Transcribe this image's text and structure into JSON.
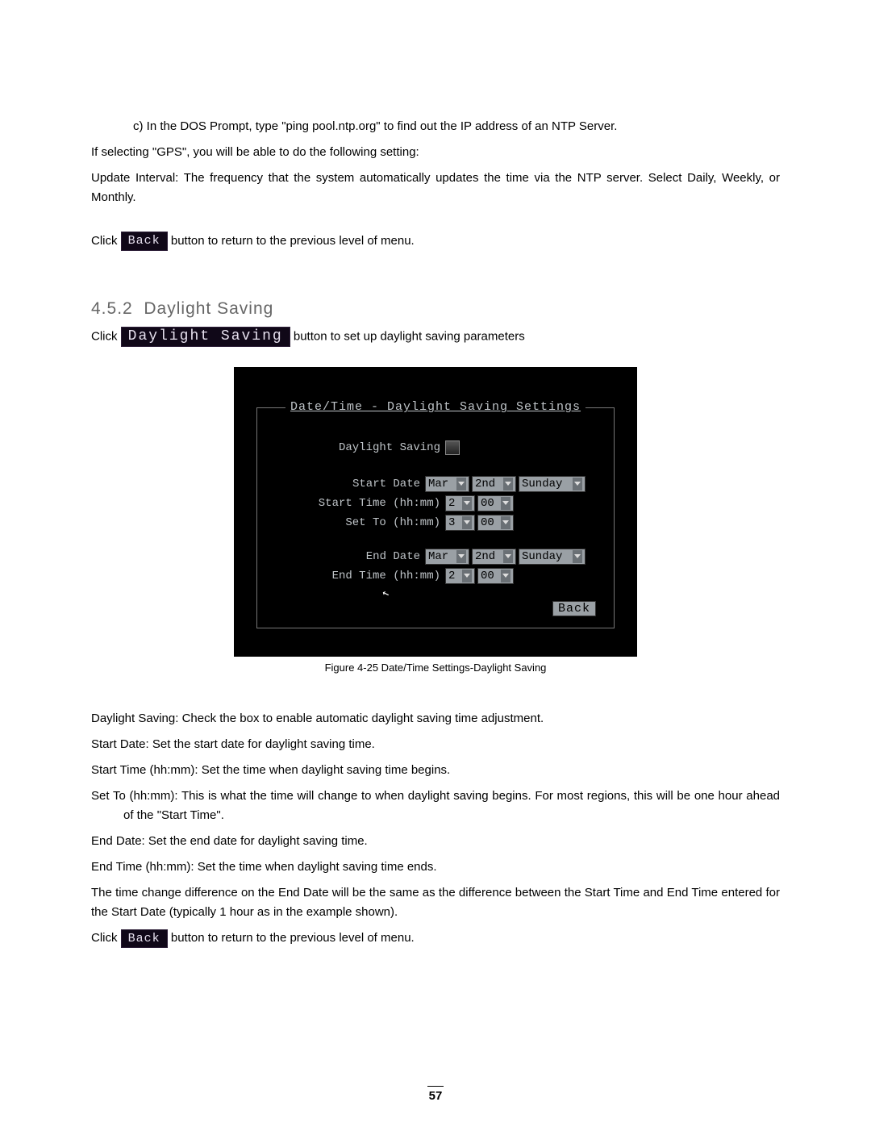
{
  "intro": {
    "line_c": "c) In the DOS Prompt, type \"ping pool.ntp.org\" to find out the IP address of an NTP Server.",
    "gps_line": "If selecting \"GPS\", you will be able to do the following setting:",
    "update_label": "Update Interval:",
    "update_text": " The frequency that the system automatically updates the time via the NTP server. Select Daily, Weekly, or Monthly.",
    "click1": "Click ",
    "back_chip": "Back",
    "click1_tail": " button to return to the previous level of menu."
  },
  "section": {
    "number": "4.5.2",
    "title": "Daylight Saving",
    "click2": "Click ",
    "ds_chip": "Daylight Saving",
    "click2_tail": " button to set up daylight saving parameters"
  },
  "dvr": {
    "title": "Date/Time - Daylight Saving Settings",
    "labels": {
      "ds": "Daylight Saving",
      "start_date": "Start Date",
      "start_time": "Start Time (hh:mm)",
      "set_to": "Set To (hh:mm)",
      "end_date": "End Date",
      "end_time": "End Time (hh:mm)"
    },
    "values": {
      "month": "Mar",
      "week": "2nd",
      "day": "Sunday",
      "h2": "2",
      "h3": "3",
      "m00": "00"
    },
    "back": "Back"
  },
  "figure_caption": "Figure 4-25 Date/Time Settings-Daylight Saving",
  "defs": {
    "daylight": {
      "term": "Daylight Saving:",
      "text": " Check the box to enable automatic daylight saving time adjustment."
    },
    "startdate": {
      "term": "Start Date:",
      "text": " Set the start date for daylight saving time."
    },
    "starttime": {
      "term": "Start Time (hh:mm):",
      "text": " Set the time when daylight saving time begins."
    },
    "setto": {
      "term": "Set To (hh:mm):",
      "text": " This is what the time will change to when daylight saving begins. For most regions, this will be one hour ahead of the \"Start Time\"."
    },
    "enddate": {
      "term": "End Date:",
      "text": " Set the end date for daylight saving time."
    },
    "endtime": {
      "term": "End Time (hh:mm):",
      "text": " Set the time when daylight saving time ends."
    }
  },
  "tail": {
    "para": "The time change difference on the End Date will be the same as the difference between the Start Time and End Time entered for the Start Date (typically 1 hour as in the example shown).",
    "click3": "Click ",
    "back_chip": "Back",
    "click3_tail": " button to return to the previous level of menu."
  },
  "page_number": "57"
}
